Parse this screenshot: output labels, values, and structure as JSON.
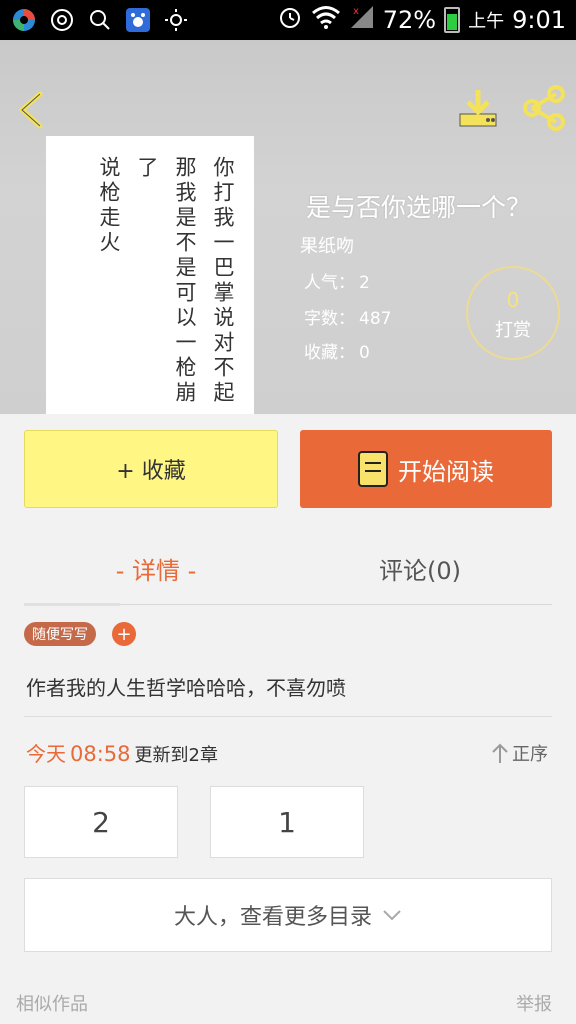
{
  "status_bar": {
    "battery": "72%",
    "ampm": "上午",
    "time": "9:01",
    "battery_level": 0.72,
    "colors": {
      "battery": "#2ecc40"
    }
  },
  "header": {
    "cover_text": [
      "你打我一巴掌说对不起",
      "那我是不是可以一枪崩了",
      "说枪走火"
    ],
    "title": "是与否你选哪一个？",
    "author": "果纸吻",
    "stats": [
      {
        "label": "人气",
        "value": "2"
      },
      {
        "label": "字数",
        "value": "487"
      },
      {
        "label": "收藏",
        "value": "0"
      }
    ],
    "tip": {
      "count": "0",
      "label": "打赏"
    }
  },
  "actions": {
    "favorite": "+ 收藏",
    "read": "开始阅读",
    "colors": {
      "favorite": "#fff684",
      "read": "#e96938"
    }
  },
  "tabs": [
    {
      "label": "- 详情 -",
      "active": true
    },
    {
      "label": "评论(0)",
      "active": false
    }
  ],
  "details": {
    "tag": "随便写写",
    "tag_add": "+",
    "description": "作者我的人生哲学哈哈哈，不喜勿喷",
    "update": {
      "day": "今天",
      "time": "08:58",
      "text": "更新到2章"
    },
    "sort": "正序",
    "chapters": [
      "2",
      "1"
    ],
    "more_toc": "大人，查看更多目录",
    "similar": "相似作品",
    "report": "举报"
  }
}
